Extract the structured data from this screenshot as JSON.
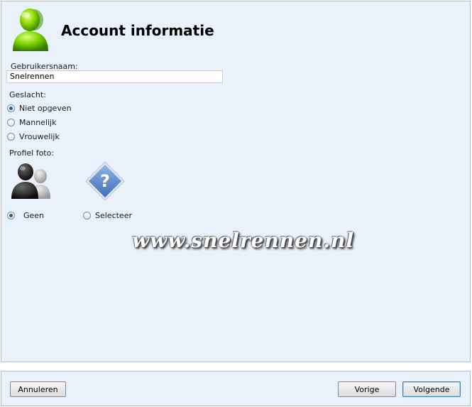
{
  "header": {
    "title": "Account informatie",
    "icon": "user-avatar-icon"
  },
  "username": {
    "label": "Gebruikersnaam:",
    "value": "Snelrennen"
  },
  "gender": {
    "label": "Geslacht:",
    "options": [
      {
        "label": "Niet opgeven",
        "checked": true
      },
      {
        "label": "Mannelijk",
        "checked": false
      },
      {
        "label": "Vrouwelijk",
        "checked": false
      }
    ]
  },
  "photo": {
    "label": "Profiel foto:",
    "options": [
      {
        "label": "Geen",
        "icon": "default-user-icon",
        "checked": true
      },
      {
        "label": "Selecteer",
        "icon": "question-mark-icon",
        "checked": false
      }
    ]
  },
  "watermark": "www.snelrennen.nl",
  "footer": {
    "cancel_label": "Annuleren",
    "back_label": "Vorige",
    "next_label": "Volgende"
  },
  "colors": {
    "accent": "#1f5fa8",
    "panel_bg": "#e9f1fa",
    "panel_border": "#a7bcd4",
    "logo_green": "#7dd400"
  }
}
